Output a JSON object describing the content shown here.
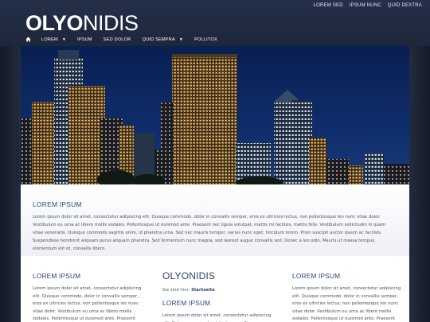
{
  "brand": {
    "logo_bold": "OLYO",
    "logo_light": "NIDIS"
  },
  "top_links": [
    "LOREM SED",
    "IPSUM NUNC",
    "QUID DEXTRA"
  ],
  "nav": {
    "home_icon": "home-icon",
    "items": [
      {
        "label": "LOREM",
        "has_dropdown": true
      },
      {
        "label": "IPSUM",
        "has_dropdown": false
      },
      {
        "label": "SED DOLOR",
        "has_dropdown": false
      },
      {
        "label": "QUID SEMPRA",
        "has_dropdown": true
      },
      {
        "label": "POLLITOX",
        "has_dropdown": false
      }
    ]
  },
  "intro": {
    "heading": "LOREM IPSUM",
    "body": "Lorem ipsum dolor sit amet, consectetur adipiscing elit. Quisque commodo, dolor in convallis semper, eros ex ultricies lectus, non pellentesque leo nunc vitae dolor. Vestibulum eu urna ac libero mollis sodales. Pellentesque ut euismod ante. Praesent nec ligula volutpat, mattis mi facilisis, mattis felis. Vestibulum sollicitudin in quam vitae venenatis. Quisque commodo sagittis enim, id pharetra urna. Sed nec mauris tempor, varius nunc eget, tincidunt lorem. Proin suscipit auctor ipsum ac facilisis. Suspendisse hendrerit aliquam purus aliquam pharetra. Sed fermentum nunc magna, sed laoreet augue convallis sed. Donec a leo odio. Mauris ut massa tempus, elementum elit et, convallis libero."
  },
  "left_col": {
    "heading": "LOREM IPSUM",
    "body": "Lorem ipsum dolor sit amet, consectetur adipiscing elit. Quisque commodo, dolor in convallis semper, eros ex ultricies lectus, non pellentesque leo nunc vitae dolor. Vestibulum eu urna ac libero mollis sodales. Pellentesque ut euismod ante. Praesent nec"
  },
  "mid_col": {
    "title": "OLYONIDIS",
    "crumb_prefix": "Sie sind hier:",
    "crumb_link": "Startseite",
    "heading": "LOREM IPSUM",
    "body": "Lorem ipsum dolor sit amet, consectetur adipiscing elit. Quisque commodo, dolor in convallis semper,"
  },
  "right_col": {
    "heading": "LOREM IPSUM",
    "body": "Lorem ipsum dolor sit amet, consectetur adipiscing elit. Quisque commodo, dolor in convallis semper, eros ex ultricies lectus, non pellentesque leo nunc vitae dolor. Vestibulum eu urna ac libero mollis sodales. Pellentesque ut euismod ante. Praesent nec"
  },
  "colors": {
    "accent": "#2e4577",
    "topbar": "#1d273b",
    "hero_sky": "#0c1a3c"
  }
}
